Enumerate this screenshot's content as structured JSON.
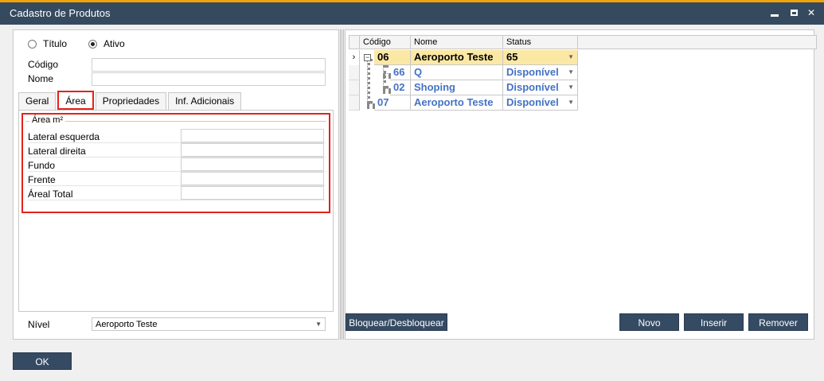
{
  "window": {
    "title": "Cadastro de Produtos"
  },
  "header": {
    "radio_titulo": "Título",
    "radio_ativo": "Ativo",
    "codigo_label": "Código",
    "nome_label": "Nome"
  },
  "tabs": [
    {
      "label": "Geral"
    },
    {
      "label": "Área"
    },
    {
      "label": "Propriedades"
    },
    {
      "label": "Inf. Adicionais"
    }
  ],
  "area_group": {
    "title": "Área m²",
    "fields": [
      {
        "label": "Lateral esquerda"
      },
      {
        "label": "Lateral direita"
      },
      {
        "label": "Fundo"
      },
      {
        "label": "Frente"
      },
      {
        "label": "Áreal Total"
      }
    ]
  },
  "nivel": {
    "label": "Nível",
    "value": "Aeroporto Teste"
  },
  "grid": {
    "columns": [
      "Código",
      "Nome",
      "Status"
    ],
    "rows": [
      {
        "codigo": "06",
        "nome": "Aeroporto Teste",
        "status": "65"
      },
      {
        "codigo": "66",
        "nome": "Q",
        "status": "Disponível"
      },
      {
        "codigo": "02",
        "nome": "Shoping",
        "status": "Disponível"
      },
      {
        "codigo": "07",
        "nome": "Aeroporto Teste",
        "status": "Disponível"
      }
    ]
  },
  "buttons": {
    "bloquear": "Bloquear/Desbloquear",
    "novo": "Novo",
    "inserir": "Inserir",
    "remover": "Remover",
    "ok": "OK"
  },
  "colors": {
    "titlebar": "#364a5f",
    "accent": "#f0a30a",
    "highlight": "#e2231a",
    "button": "#354b63",
    "grid_link": "#4472c4",
    "grid_selected": "#fbe8a4"
  }
}
